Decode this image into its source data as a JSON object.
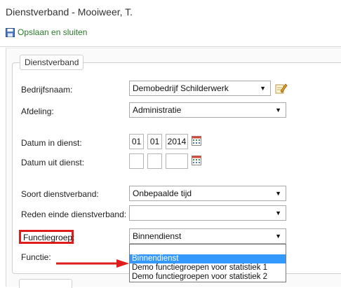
{
  "window": {
    "title": "Dienstverband - Mooiweer, T."
  },
  "toolbar": {
    "save_label": "Opslaan en sluiten"
  },
  "section": {
    "legend": "Dienstverband"
  },
  "form": {
    "bedrijfsnaam": {
      "label": "Bedrijfsnaam:",
      "value": "Demobedrijf Schilderwerk"
    },
    "afdeling": {
      "label": "Afdeling:",
      "value": "Administratie"
    },
    "datum_in": {
      "label": "Datum in dienst:",
      "day": "01",
      "month": "01",
      "year": "2014"
    },
    "datum_uit": {
      "label": "Datum uit dienst:",
      "day": "",
      "month": "",
      "year": ""
    },
    "soort": {
      "label": "Soort dienstverband:",
      "value": "Onbepaalde tijd"
    },
    "reden": {
      "label": "Reden einde dienstverband:",
      "value": ""
    },
    "functiegroep": {
      "label": "Functiegroep:",
      "value": "Binnendienst",
      "options": [
        "",
        "Binnendienst",
        "Demo functiegroepen voor statistiek 1",
        "Demo functiegroepen voor statistiek 2"
      ],
      "selected_option": "Binnendienst"
    },
    "functie": {
      "label": "Functie:"
    }
  },
  "colors": {
    "highlight": "#e01b1b",
    "selected": "#3399ff",
    "save_link": "#2a7a2a"
  },
  "icons": [
    "save-icon",
    "edit-icon",
    "calendar-icon",
    "arrow-icon"
  ]
}
